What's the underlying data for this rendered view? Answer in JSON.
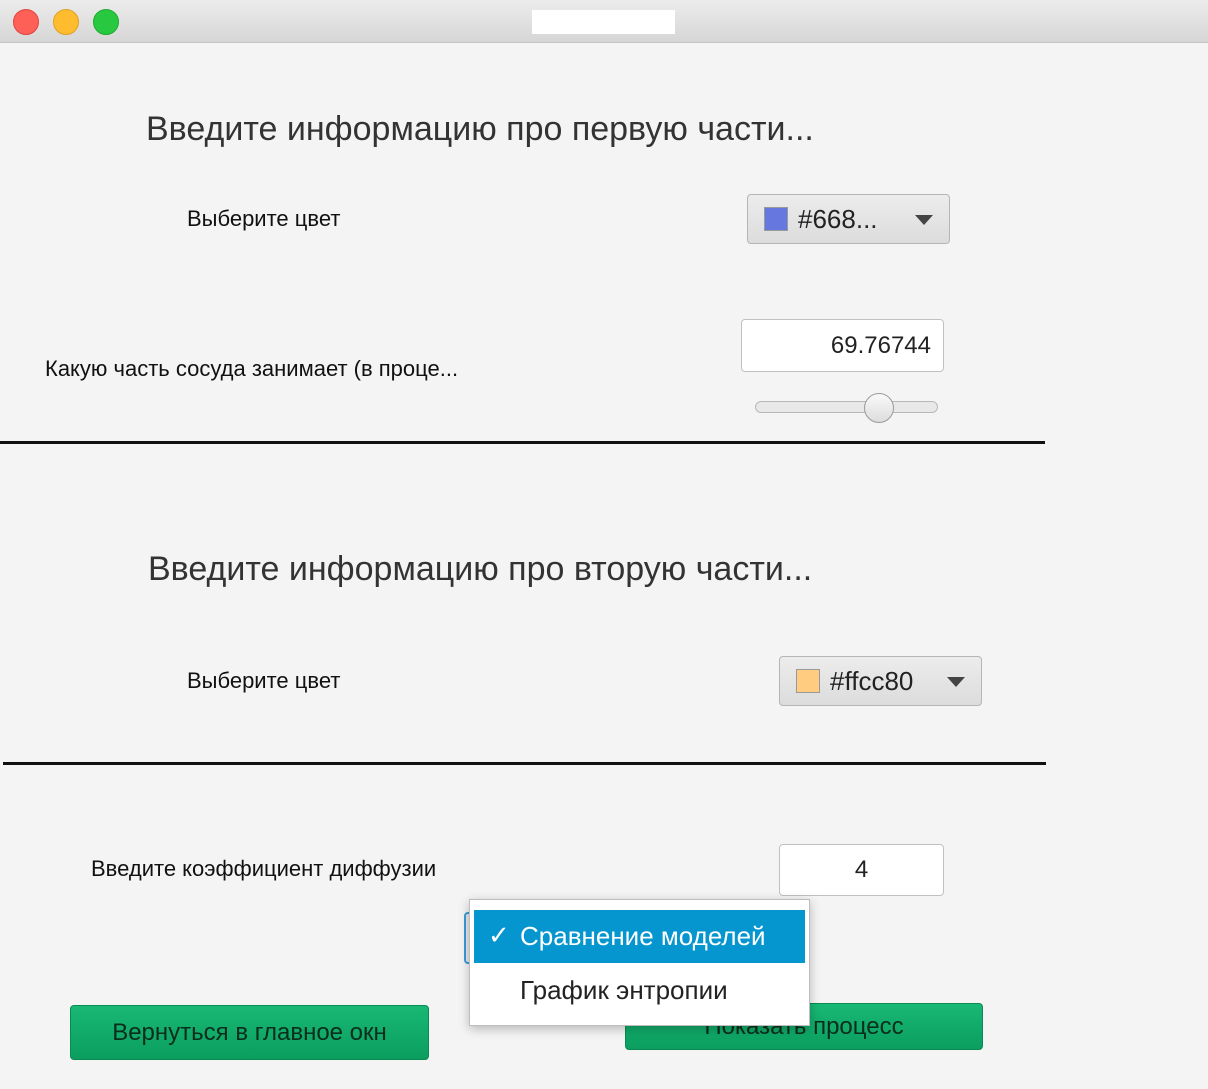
{
  "window": {
    "title": ""
  },
  "section1": {
    "heading": "Введите информацию про первую части...",
    "color_label": "Выберите цвет",
    "color_value": "#668...",
    "color_swatch": "#6678e0",
    "volume_label": "Какую часть сосуда занимает (в проце...",
    "volume_value": "69.76744",
    "slider_fraction": 0.6976744
  },
  "section2": {
    "heading": "Введите информацию про вторую части...",
    "color_label": "Выберите цвет",
    "color_value": "#ffcc80",
    "color_swatch": "#ffcc80"
  },
  "diffusion": {
    "label": "Введите коэффициент диффузии",
    "value": "4"
  },
  "mode_dropdown": {
    "options": [
      "Сравнение моделей",
      "График энтропии"
    ],
    "selected": "Сравнение моделей",
    "check_mark": "✓"
  },
  "buttons": {
    "back": "Вернуться в главное окн",
    "show_process": "Показать процесс"
  },
  "colors": {
    "accent_green": "#0fae68",
    "selection_blue": "#0596d0"
  }
}
